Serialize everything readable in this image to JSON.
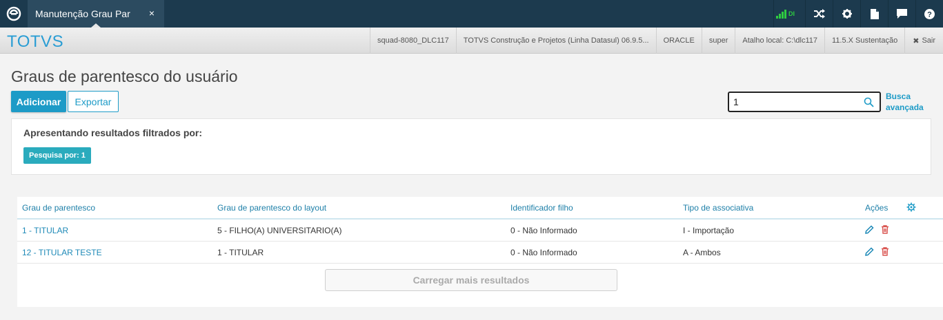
{
  "topbar": {
    "tab_title": "Manutenção Grau Par",
    "tab_close": "×",
    "signal_label": "DI"
  },
  "header": {
    "brand": "TOTVS",
    "info": [
      "squad-8080_DLC117",
      "TOTVS Construção e Projetos (Linha Datasul) 06.9.5...",
      "ORACLE",
      "super",
      "Atalho local: C:\\dlc117",
      "11.5.X Sustentação"
    ],
    "exit_label": "Sair"
  },
  "page": {
    "title": "Graus de parentesco do usuário",
    "add_label": "Adicionar",
    "export_label": "Exportar",
    "search_value": "1",
    "adv_search_line1": "Busca",
    "adv_search_line2": "avançada"
  },
  "filter": {
    "title": "Apresentando resultados filtrados por:",
    "chip": "Pesquisa por: 1"
  },
  "table": {
    "headers": [
      "Grau de parentesco",
      "Grau de parentesco do layout",
      "Identificador filho",
      "Tipo de associativa",
      "Ações"
    ],
    "rows": [
      [
        "1 - TITULAR",
        "5 - FILHO(A) UNIVERSITARIO(A)",
        "0 - Não Informado",
        "I - Importação"
      ],
      [
        "12 - TITULAR TESTE",
        "1 - TITULAR",
        "0 - Não Informado",
        "A - Ambos"
      ]
    ]
  },
  "load_more": "Carregar mais resultados",
  "colors": {
    "topbar": "#1c3a4e",
    "accent": "#1d9bc7",
    "chip": "#2aabbd",
    "delete": "#d9534f",
    "signal": "#2ecc40"
  }
}
